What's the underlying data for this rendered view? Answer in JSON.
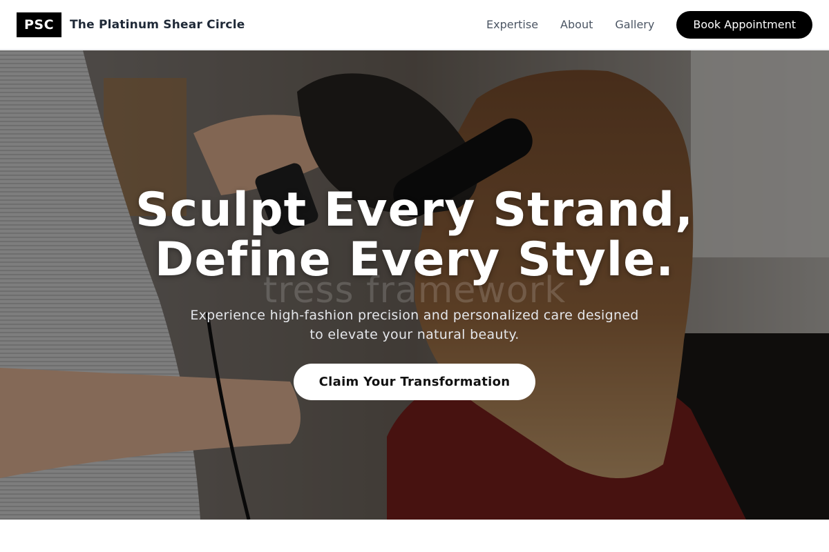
{
  "nav": {
    "logo": "PSC",
    "brand_name": "The Platinum Shear Circle",
    "links": [
      "Expertise",
      "About",
      "Gallery"
    ],
    "cta": "Book Appointment"
  },
  "hero": {
    "title_line1": "Sculpt Every Strand,",
    "title_line2": "Define Every Style.",
    "watermark": "tress framework",
    "subtitle_line1": "Experience high-fashion precision and personalized care designed",
    "subtitle_line2": "to elevate your natural beauty.",
    "cta": "Claim Your Transformation"
  },
  "colors": {
    "accent": "#000000",
    "nav_text": "#4b5563",
    "overlay": "rgba(0,0,0,0.42)"
  }
}
